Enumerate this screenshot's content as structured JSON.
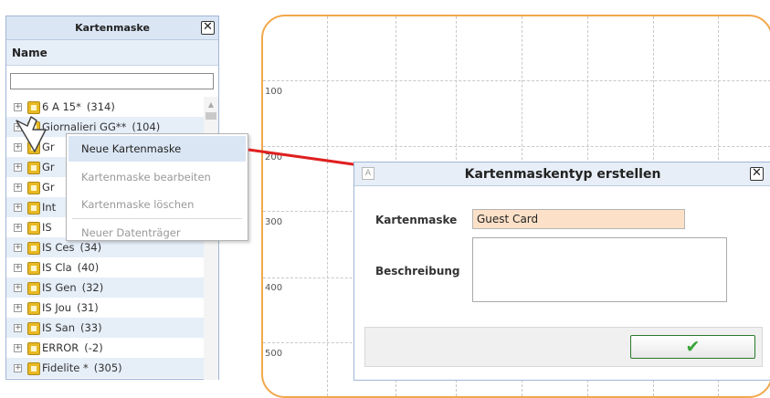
{
  "canvas": {
    "rulers": [
      "100",
      "200",
      "300",
      "400",
      "500"
    ]
  },
  "panel": {
    "title": "Kartenmaske",
    "close": "✕",
    "column_header": "Name",
    "filter_value": "",
    "items": [
      {
        "label": "6 A 15*",
        "count": "(314)"
      },
      {
        "label": "Giornalieri GG**",
        "count": "(104)"
      },
      {
        "label": "Gr",
        "count": ""
      },
      {
        "label": "Gr",
        "count": ""
      },
      {
        "label": "Gr",
        "count": ""
      },
      {
        "label": "Int",
        "count": ""
      },
      {
        "label": "IS",
        "count": ""
      },
      {
        "label": "IS Ces",
        "count": "(34)"
      },
      {
        "label": "IS Cla",
        "count": "(40)"
      },
      {
        "label": "IS Gen",
        "count": "(32)"
      },
      {
        "label": "IS Jou",
        "count": "(31)"
      },
      {
        "label": "IS San",
        "count": "(33)"
      },
      {
        "label": "ERROR",
        "count": "(-2)"
      },
      {
        "label": "Fidelite *",
        "count": "(305)"
      }
    ]
  },
  "context_menu": {
    "items": [
      "Neue Kartenmaske",
      "Kartenmaske bearbeiten",
      "Kartenmaske löschen",
      "Neuer Datenträger"
    ]
  },
  "dialog": {
    "title": "Kartenmaskentyp erstellen",
    "icon": "A",
    "close": "✕",
    "name_label": "Kartenmaske",
    "name_value": "Guest Card",
    "desc_label": "Beschreibung",
    "desc_value": "",
    "ok": "✔"
  },
  "colors": {
    "canvas_border": "#f2a84c",
    "arrow": "#e02020",
    "input_bg": "#fce1c8",
    "ok_check": "#3aa53a",
    "menu_highlight": "#dbe6f4"
  }
}
